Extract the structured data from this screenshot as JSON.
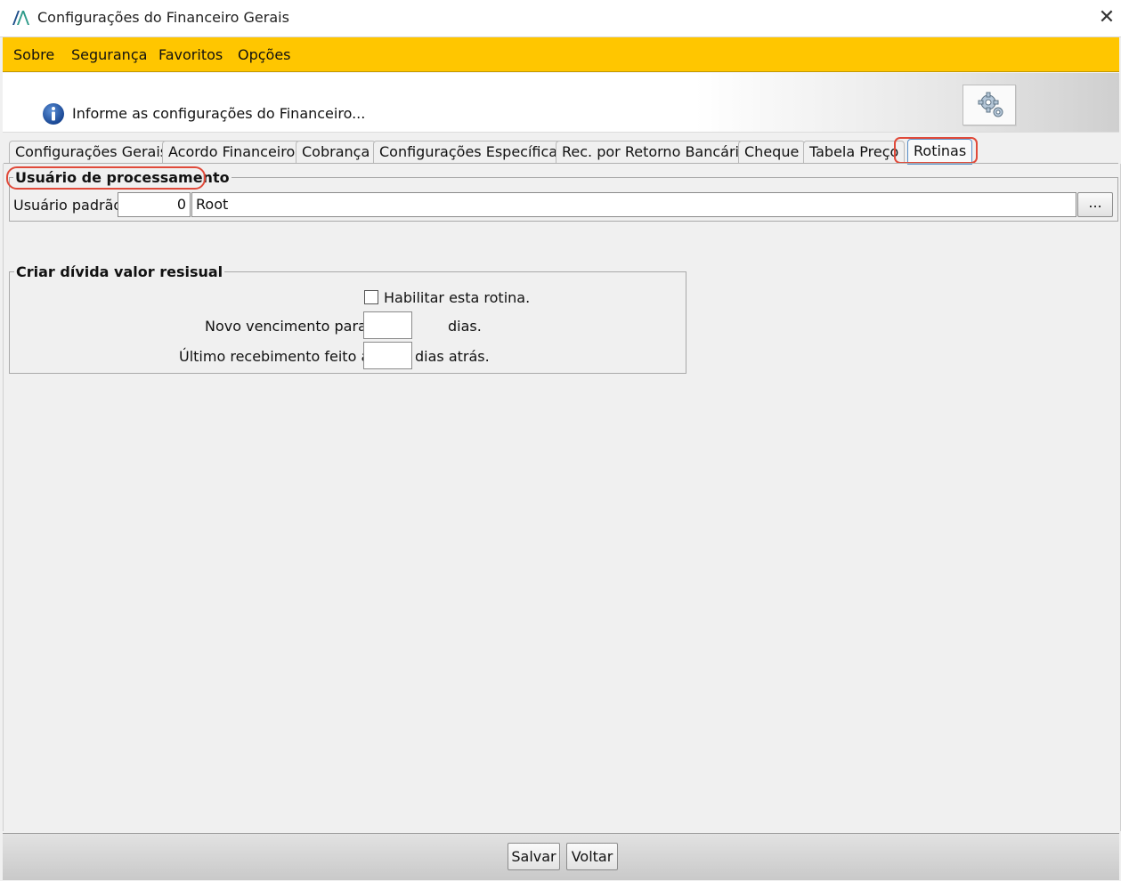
{
  "window": {
    "title": "Configurações do Financeiro Gerais",
    "close_glyph": "✕"
  },
  "menu": {
    "sobre": "Sobre",
    "seguranca": "Segurança",
    "favoritos": "Favoritos",
    "opcoes": "Opções"
  },
  "header": {
    "info_text": "Informe as configurações do Financeiro...",
    "info_icon": "info-icon",
    "config_icon": "gear-icon"
  },
  "tabs": [
    {
      "label": "Configurações Gerais"
    },
    {
      "label": "Acordo Financeiro"
    },
    {
      "label": "Cobrança"
    },
    {
      "label": "Configurações Específicas"
    },
    {
      "label": "Rec. por Retorno Bancário"
    },
    {
      "label": "Cheque"
    },
    {
      "label": "Tabela Preço"
    },
    {
      "label": "Rotinas",
      "active": true
    }
  ],
  "usuario_group": {
    "legend": "Usuário de processamento",
    "label": "Usuário padrão:",
    "code": "0",
    "name": "Root",
    "browse_label": "..."
  },
  "divida_group": {
    "legend": "Criar dívida valor resisual",
    "checkbox_label": "Habilitar esta rotina.",
    "checkbox_checked": false,
    "novo_vencimento_label": "Novo vencimento para:",
    "novo_vencimento_value": "",
    "novo_vencimento_suffix": "dias.",
    "ultimo_recebimento_label": "Último recebimento feito á:",
    "ultimo_recebimento_value": "",
    "ultimo_recebimento_suffix": "dias atrás."
  },
  "footer": {
    "salvar": "Salvar",
    "voltar": "Voltar"
  },
  "colors": {
    "menubar": "#ffc600",
    "highlight": "#e04a3a",
    "active_tab_border": "#5a8fc8"
  }
}
